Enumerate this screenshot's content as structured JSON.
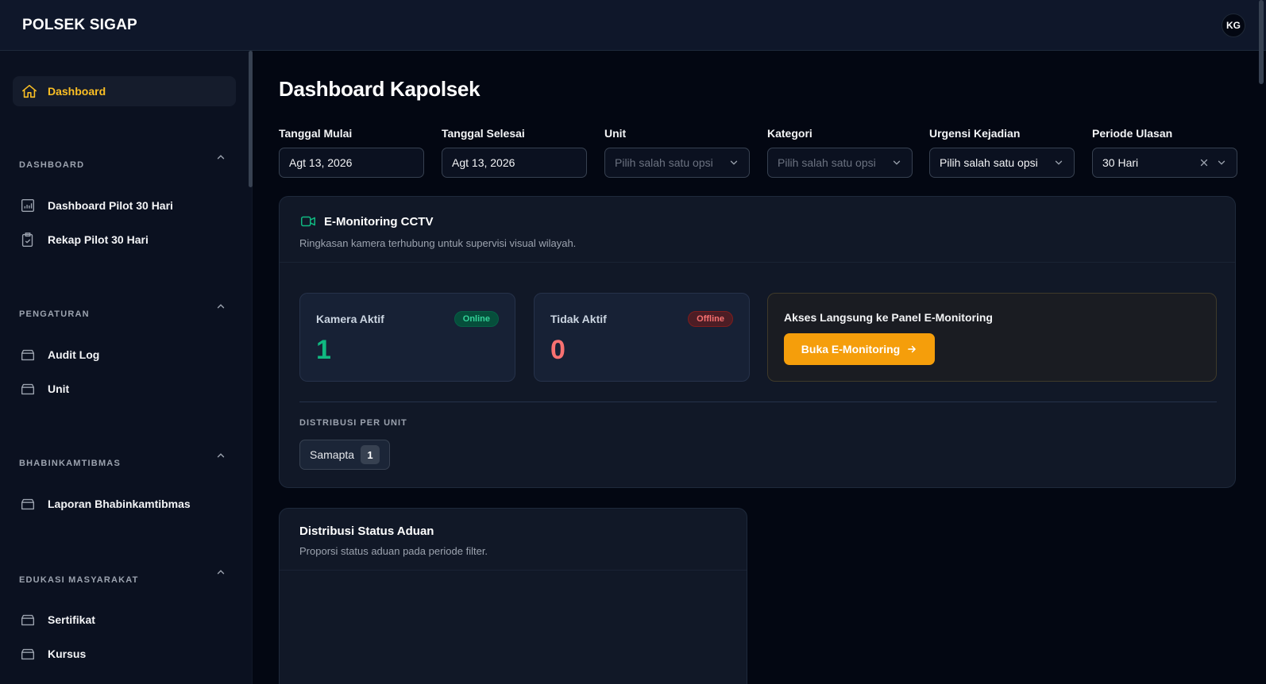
{
  "app": {
    "brand": "POLSEK SIGAP",
    "avatar_initials": "KG"
  },
  "sidebar": {
    "active": {
      "label": "Dashboard",
      "icon": "home-icon"
    },
    "groups": [
      {
        "label": "DASHBOARD",
        "items": [
          {
            "label": "Dashboard Pilot 30 Hari",
            "icon": "bar-chart-icon"
          },
          {
            "label": "Rekap Pilot 30 Hari",
            "icon": "clipboard-check-icon"
          }
        ]
      },
      {
        "label": "PENGATURAN",
        "items": [
          {
            "label": "Audit Log",
            "icon": "archive-box-icon"
          },
          {
            "label": "Unit",
            "icon": "archive-box-icon"
          }
        ]
      },
      {
        "label": "BHABINKAMTIBMAS",
        "items": [
          {
            "label": "Laporan Bhabinkamtibmas",
            "icon": "archive-box-icon"
          }
        ]
      },
      {
        "label": "EDUKASI MASYARAKAT",
        "items": [
          {
            "label": "Sertifikat",
            "icon": "archive-box-icon"
          },
          {
            "label": "Kursus",
            "icon": "archive-box-icon"
          }
        ]
      }
    ]
  },
  "page": {
    "title": "Dashboard Kapolsek"
  },
  "filters": [
    {
      "label": "Tanggal Mulai",
      "value": "Agt 13, 2026",
      "placeholder": ""
    },
    {
      "label": "Tanggal Selesai",
      "value": "Agt 13, 2026",
      "placeholder": ""
    },
    {
      "label": "Unit",
      "value": "",
      "placeholder": "Pilih salah satu opsi"
    },
    {
      "label": "Kategori",
      "value": "",
      "placeholder": "Pilih salah satu opsi"
    },
    {
      "label": "Urgensi Kejadian",
      "value": "Pilih salah satu opsi",
      "placeholder": ""
    },
    {
      "label": "Periode Ulasan",
      "value": "30 Hari",
      "placeholder": ""
    }
  ],
  "cctv": {
    "title": "E-Monitoring CCTV",
    "subtitle": "Ringkasan kamera terhubung untuk supervisi visual wilayah.",
    "active": {
      "label": "Kamera Aktif",
      "badge": "Online",
      "value": "1"
    },
    "inactive": {
      "label": "Tidak Aktif",
      "badge": "Offline",
      "value": "0"
    },
    "access": {
      "title": "Akses Langsung ke Panel E-Monitoring",
      "button": "Buka E-Monitoring"
    },
    "distribution": {
      "label": "DISTRIBUSI PER UNIT",
      "units": [
        {
          "name": "Samapta",
          "count": "1"
        }
      ]
    }
  },
  "status_card": {
    "title": "Distribusi Status Aduan",
    "subtitle": "Proporsi status aduan pada periode filter."
  },
  "colors": {
    "accent": "#f59e0b",
    "success": "#10b981",
    "danger": "#f87171",
    "background": "#030712",
    "panel": "#111827"
  }
}
